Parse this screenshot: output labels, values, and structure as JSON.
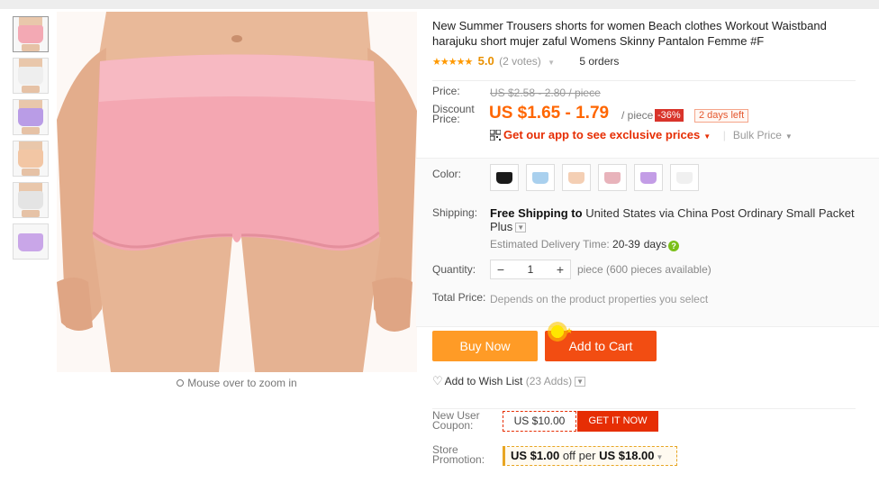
{
  "product": {
    "title": "New Summer Trousers shorts for women Beach clothes Workout Waistband harajuku short mujer zaful Womens Skinny Pantalon Femme #F",
    "stars": "★★★★★",
    "rating": "5.0",
    "votes": "(2 votes)",
    "orders": "5 orders"
  },
  "gallery": {
    "thumbnails": [
      {
        "color": "#f3a9b4"
      },
      {
        "color": "#eeeeee"
      },
      {
        "color": "#b99ce6"
      },
      {
        "color": "#f2c6a4"
      },
      {
        "color": "#e4e4e4"
      },
      {
        "color": "#c9a6e8"
      }
    ],
    "zoom_hint": "Mouse over to zoom in"
  },
  "pricing": {
    "price_label": "Price:",
    "old_price": "US $2.58 - 2.80 / piece",
    "discount_label": "Discount Price:",
    "discount_price": "US $1.65 - 1.79",
    "per_piece": "/ piece",
    "discount_pct": "-36%",
    "days_left": "2 days left",
    "app_link": "Get our app to see exclusive prices",
    "bulk_price": "Bulk Price"
  },
  "colors": {
    "label": "Color:",
    "swatches": [
      "#1b1b1b",
      "#a9d0ee",
      "#f4cfb4",
      "#e8b3bb",
      "#c39de6",
      "#f0f0f0"
    ]
  },
  "shipping": {
    "label": "Shipping:",
    "free": "Free Shipping to",
    "details": "United States via China Post Ordinary Small Packet Plus",
    "est_label": "Estimated Delivery Time:",
    "est_days": "20-39",
    "days_word": "days"
  },
  "quantity": {
    "label": "Quantity:",
    "minus": "−",
    "value": "1",
    "plus": "+",
    "note": "piece (600 pieces available)"
  },
  "total": {
    "label": "Total Price:",
    "note": "Depends on the product properties you select"
  },
  "actions": {
    "buy_now": "Buy Now",
    "add_to_cart": "Add to Cart",
    "wish_list": "Add to Wish List",
    "wish_count": "(23 Adds)"
  },
  "coupon": {
    "label": "New User Coupon:",
    "value": "US $10.00",
    "button": "GET IT NOW"
  },
  "store_promo": {
    "label": "Store Promotion:",
    "amount": "US $1.00",
    "mid": "off per",
    "threshold": "US $18.00"
  },
  "theme": {
    "accent_orange": "#f60",
    "cart_red": "#f24d12",
    "buy_orange": "#ff9b26",
    "product_pink": "#f4a7b2"
  }
}
